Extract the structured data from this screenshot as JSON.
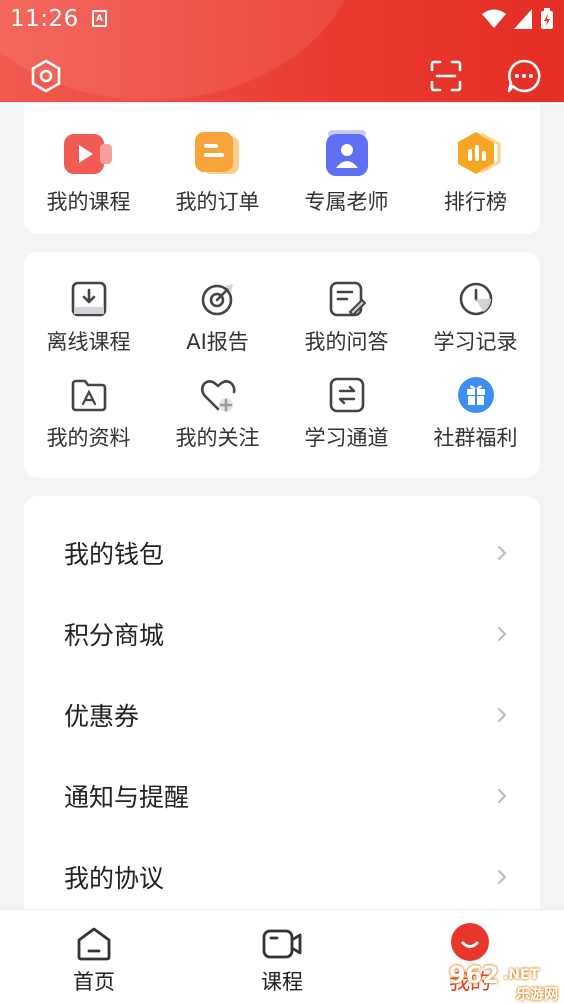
{
  "status": {
    "time": "11:26",
    "app_glyph": "A"
  },
  "header": {
    "settings_icon": "hexagon-settings-icon",
    "scan_icon": "scan-icon",
    "message_icon": "chat-bubble-icon"
  },
  "top_shortcuts": [
    {
      "label": "我的课程",
      "icon": "video-course-icon",
      "color": "#f0504a"
    },
    {
      "label": "我的订单",
      "icon": "order-document-icon",
      "color": "#f7a53a"
    },
    {
      "label": "专属老师",
      "icon": "teacher-icon",
      "color": "#5b6cf0"
    },
    {
      "label": "排行榜",
      "icon": "ranking-chart-icon",
      "color": "#f5a623"
    }
  ],
  "tools": [
    {
      "label": "离线课程",
      "icon": "download-icon"
    },
    {
      "label": "AI报告",
      "icon": "ai-report-icon"
    },
    {
      "label": "我的问答",
      "icon": "qa-edit-icon"
    },
    {
      "label": "学习记录",
      "icon": "clock-icon"
    },
    {
      "label": "我的资料",
      "icon": "folder-icon"
    },
    {
      "label": "我的关注",
      "icon": "heart-add-icon"
    },
    {
      "label": "学习通道",
      "icon": "switch-channel-icon"
    },
    {
      "label": "社群福利",
      "icon": "gift-icon"
    }
  ],
  "menu": [
    {
      "label": "我的钱包"
    },
    {
      "label": "积分商城"
    },
    {
      "label": "优惠券"
    },
    {
      "label": "通知与提醒"
    },
    {
      "label": "我的协议"
    }
  ],
  "tabbar": {
    "home": "首页",
    "course": "课程",
    "mine": "我的"
  },
  "watermark": {
    "text": "962",
    "suffix": ".NET",
    "sub": "乐游网"
  },
  "colors": {
    "brand_red": "#e9362c",
    "accent_blue": "#3d8ef2"
  }
}
